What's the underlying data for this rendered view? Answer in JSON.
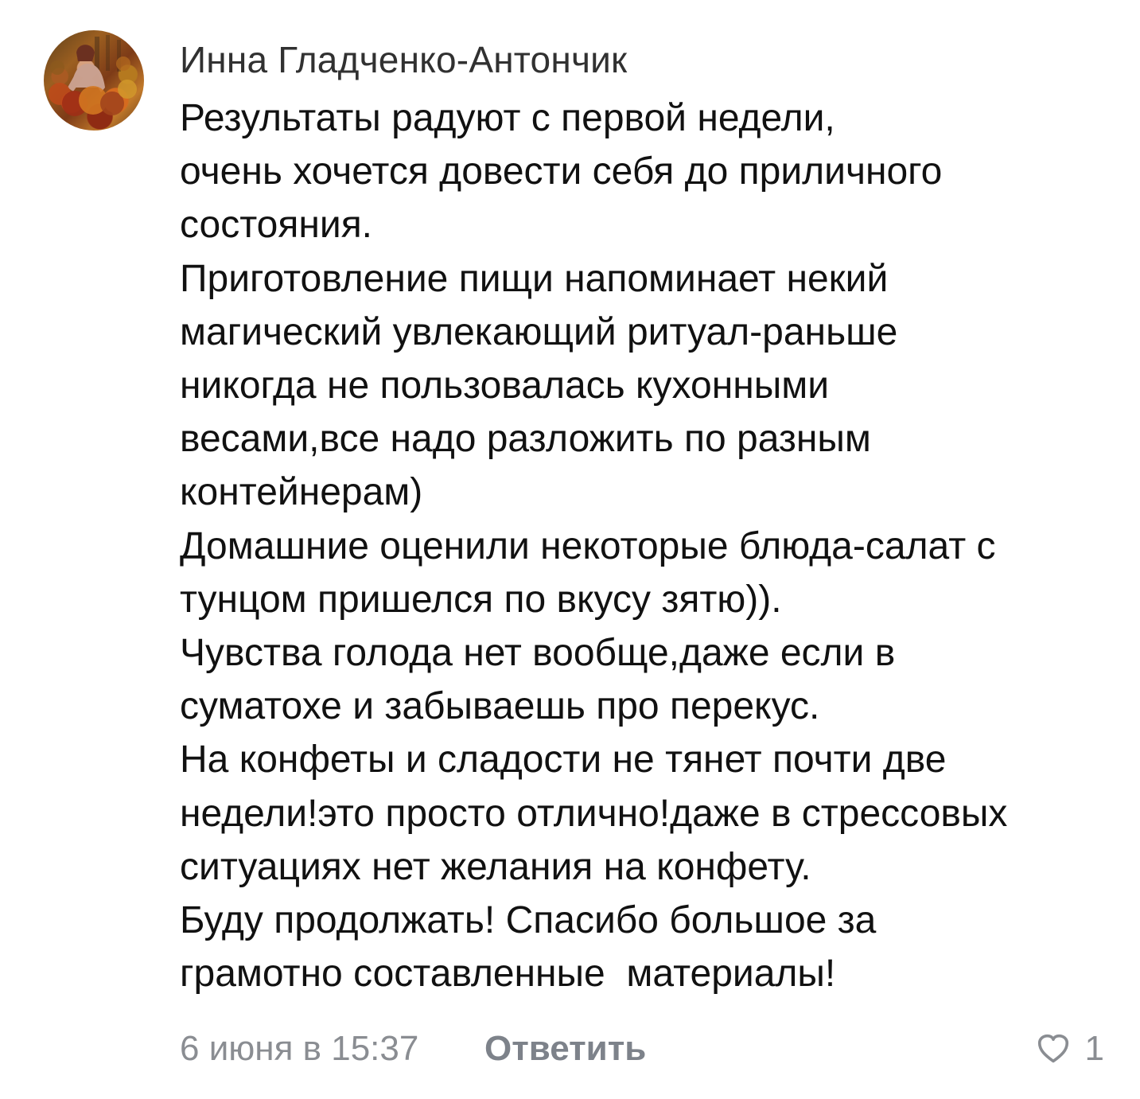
{
  "comment": {
    "author": {
      "name": "Инна Гладченко-Антончик",
      "avatar_icon": "profile-photo"
    },
    "text_lines": [
      "Результаты радуют с первой недели,",
      "очень хочется довести себя до приличного",
      "состояния.",
      "Приготовление пищи напоминает некий",
      "магический увлекающий ритуал-раньше",
      "никогда не пользовалась кухонными",
      "весами,все надо разложить по разным",
      "контейнерам)",
      "Домашние оценили некоторые блюда-салат с",
      "тунцом пришелся по вкусу зятю)).",
      "Чувства голода нет вообще,даже если в",
      "суматохе и забываешь про перекус.",
      "На конфеты и сладости не тянет почти две",
      "недели!это просто отлично!даже в стрессовых",
      "ситуациях нет желания на конфету.",
      "Буду продолжать! Спасибо большое за",
      "грамотно составленные  материалы!"
    ],
    "footer": {
      "date": "6 июня в 15:37",
      "reply_label": "Ответить",
      "likes_count": "1",
      "like_icon": "heart-outline-icon"
    },
    "colors": {
      "author": "#313131",
      "text": "#111111",
      "meta": "#8a8d92",
      "reply": "#7d828a",
      "background": "#ffffff"
    }
  }
}
